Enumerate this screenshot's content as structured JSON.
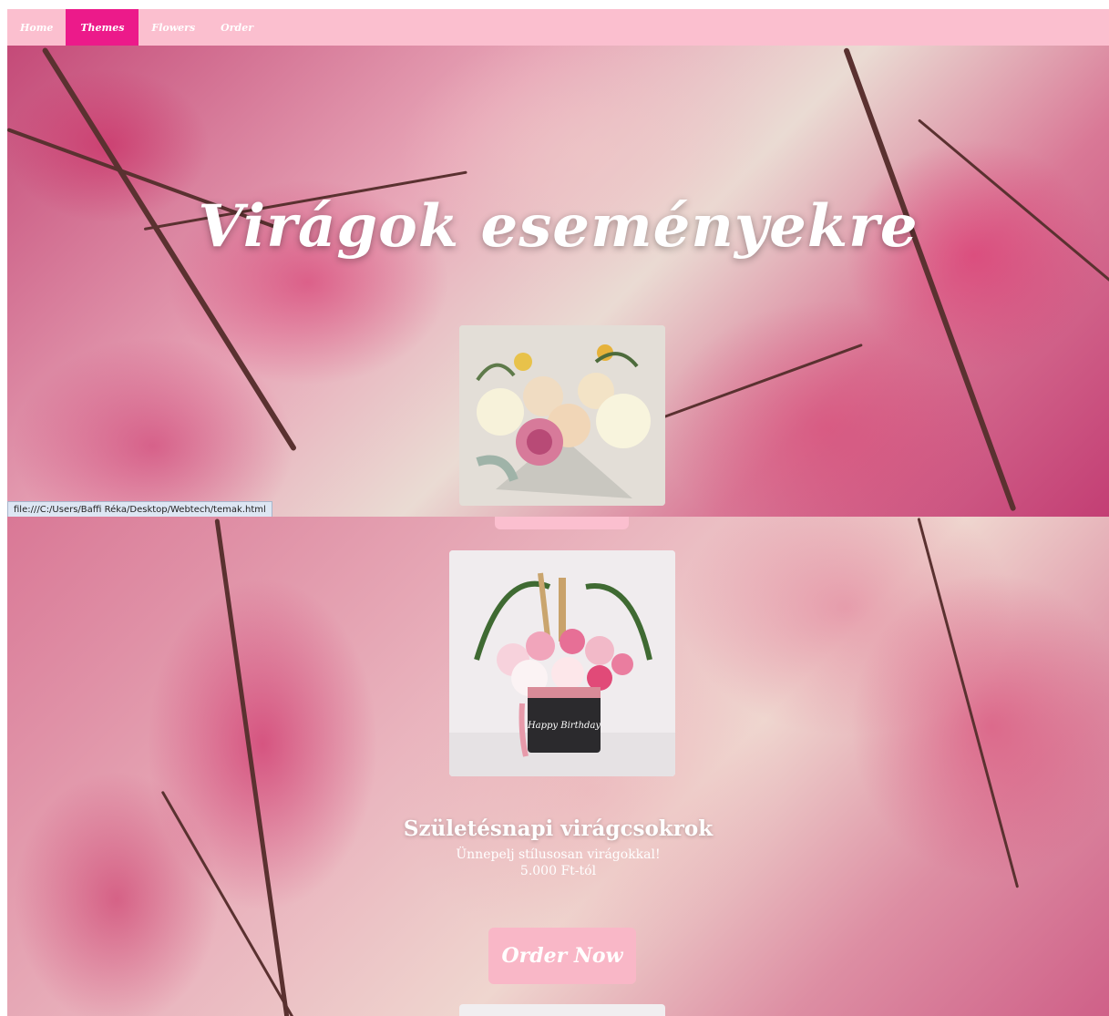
{
  "nav": {
    "items": [
      {
        "label": "Home",
        "active": false
      },
      {
        "label": "Themes",
        "active": true
      },
      {
        "label": "Flowers",
        "active": false
      },
      {
        "label": "Order",
        "active": false
      }
    ]
  },
  "hero": {
    "title": "Virágok eseményekre"
  },
  "status_bar": {
    "url": "file:///C:/Users/Baffi Réka/Desktop/Webtech/temak.html"
  },
  "section": {
    "title": "Születésnapi virágcsokrok",
    "description": "Ünnepelj stílusosan virágokkal!",
    "price": "5.000 Ft-tól",
    "button_label": "Order Now",
    "box_label": "Happy Birthday"
  },
  "colors": {
    "nav_bg": "#fbbfcf",
    "nav_active": "#ec1a8a",
    "button_bg": "#f9b7c7",
    "text": "#ffffff"
  }
}
